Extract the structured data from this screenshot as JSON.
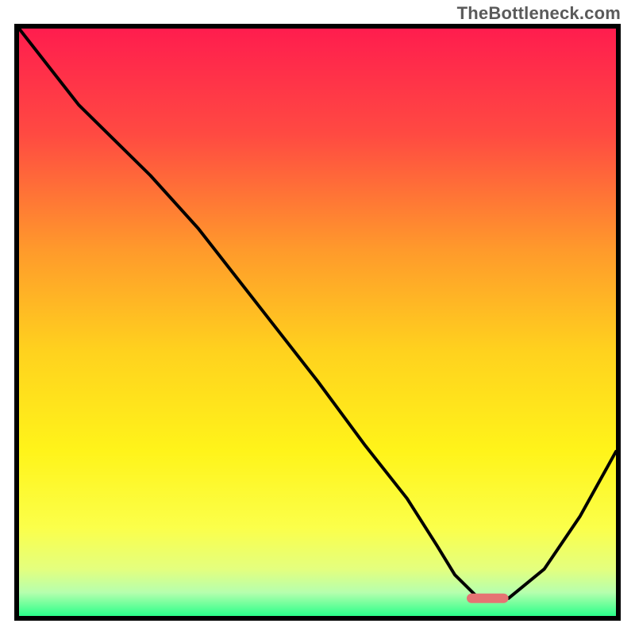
{
  "watermark": "TheBottleneck.com",
  "chart_data": {
    "type": "line",
    "title": "",
    "xlabel": "",
    "ylabel": "",
    "xlim": [
      0,
      100
    ],
    "ylim": [
      0,
      100
    ],
    "grid": false,
    "legend": false,
    "gradient_stops": [
      {
        "offset": 0.0,
        "color": "#ff1d4e"
      },
      {
        "offset": 0.18,
        "color": "#ff4a42"
      },
      {
        "offset": 0.38,
        "color": "#ff9b2b"
      },
      {
        "offset": 0.55,
        "color": "#ffd21e"
      },
      {
        "offset": 0.72,
        "color": "#fff41a"
      },
      {
        "offset": 0.85,
        "color": "#fbff4a"
      },
      {
        "offset": 0.92,
        "color": "#e4ff7e"
      },
      {
        "offset": 0.96,
        "color": "#b6ffae"
      },
      {
        "offset": 1.0,
        "color": "#2bff8a"
      }
    ],
    "series": [
      {
        "name": "bottleneck-curve",
        "x": [
          0,
          10,
          22,
          30,
          40,
          50,
          58,
          65,
          70,
          73,
          77,
          82,
          88,
          94,
          100
        ],
        "y": [
          100,
          87,
          75,
          66,
          53,
          40,
          29,
          20,
          12,
          7,
          3,
          3,
          8,
          17,
          28
        ]
      }
    ],
    "marker": {
      "name": "optimal-range",
      "x_start": 75,
      "x_end": 82,
      "y": 3,
      "color": "#e57373"
    }
  }
}
